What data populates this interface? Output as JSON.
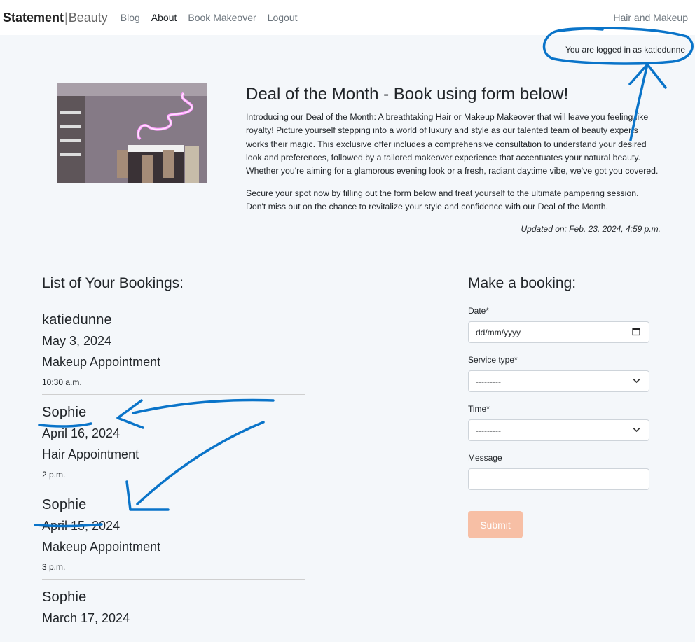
{
  "nav": {
    "brand_bold": "Statement",
    "brand_sep": "|",
    "brand_light": "Beauty",
    "links": [
      "Blog",
      "About",
      "Book Makeover",
      "Logout"
    ],
    "right": "Hair and Makeup"
  },
  "user": {
    "logged_in_text": "You are logged in as katiedunne"
  },
  "hero": {
    "title": "Deal of the Month - Book using form below!",
    "paragraph1": "Introducing our Deal of the Month: A breathtaking Hair or Makeup Makeover that will leave you feeling like royalty! Picture yourself stepping into a world of luxury and style as our talented team of beauty experts works their magic. This exclusive offer includes a comprehensive consultation to understand your desired look and preferences, followed by a tailored makeover experience that accentuates your natural beauty. Whether you're aiming for a glamorous evening look or a fresh, radiant daytime vibe, we've got you covered.",
    "paragraph2": "Secure your spot now by filling out the form below and treat yourself to the ultimate pampering session. Don't miss out on the chance to revitalize your style and confidence with our Deal of the Month.",
    "updated": "Updated on: Feb. 23, 2024, 4:59 p.m."
  },
  "bookings": {
    "title": "List of Your Bookings:",
    "items": [
      {
        "name": "katiedunne",
        "date": "May 3, 2024",
        "service": "Makeup Appointment",
        "time": "10:30 a.m."
      },
      {
        "name": "Sophie",
        "date": "April 16, 2024",
        "service": "Hair Appointment",
        "time": "2 p.m."
      },
      {
        "name": "Sophie",
        "date": "April 15, 2024",
        "service": "Makeup Appointment",
        "time": "3 p.m."
      },
      {
        "name": "Sophie",
        "date": "March 17, 2024",
        "service": "",
        "time": ""
      }
    ]
  },
  "form": {
    "title": "Make a booking:",
    "date_label": "Date*",
    "date_value": "dd/mm/yyyy",
    "service_label": "Service type*",
    "service_value": "---------",
    "time_label": "Time*",
    "time_value": "---------",
    "message_label": "Message",
    "message_value": "",
    "submit": "Submit"
  },
  "colors": {
    "annotation": "#0a74c9",
    "submit_bg": "#f7bfa5",
    "page_bg": "#f4f7fa"
  }
}
